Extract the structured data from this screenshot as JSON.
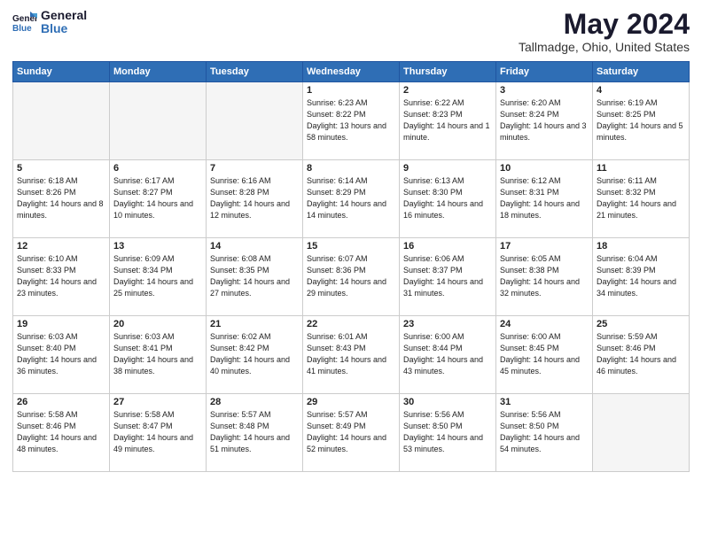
{
  "header": {
    "logo_general": "General",
    "logo_blue": "Blue",
    "month_title": "May 2024",
    "location": "Tallmadge, Ohio, United States"
  },
  "weekdays": [
    "Sunday",
    "Monday",
    "Tuesday",
    "Wednesday",
    "Thursday",
    "Friday",
    "Saturday"
  ],
  "weeks": [
    [
      {
        "day": "",
        "empty": true
      },
      {
        "day": "",
        "empty": true
      },
      {
        "day": "",
        "empty": true
      },
      {
        "day": "1",
        "sunrise": "6:23 AM",
        "sunset": "8:22 PM",
        "daylight": "13 hours and 58 minutes."
      },
      {
        "day": "2",
        "sunrise": "6:22 AM",
        "sunset": "8:23 PM",
        "daylight": "14 hours and 1 minute."
      },
      {
        "day": "3",
        "sunrise": "6:20 AM",
        "sunset": "8:24 PM",
        "daylight": "14 hours and 3 minutes."
      },
      {
        "day": "4",
        "sunrise": "6:19 AM",
        "sunset": "8:25 PM",
        "daylight": "14 hours and 5 minutes."
      }
    ],
    [
      {
        "day": "5",
        "sunrise": "6:18 AM",
        "sunset": "8:26 PM",
        "daylight": "14 hours and 8 minutes."
      },
      {
        "day": "6",
        "sunrise": "6:17 AM",
        "sunset": "8:27 PM",
        "daylight": "14 hours and 10 minutes."
      },
      {
        "day": "7",
        "sunrise": "6:16 AM",
        "sunset": "8:28 PM",
        "daylight": "14 hours and 12 minutes."
      },
      {
        "day": "8",
        "sunrise": "6:14 AM",
        "sunset": "8:29 PM",
        "daylight": "14 hours and 14 minutes."
      },
      {
        "day": "9",
        "sunrise": "6:13 AM",
        "sunset": "8:30 PM",
        "daylight": "14 hours and 16 minutes."
      },
      {
        "day": "10",
        "sunrise": "6:12 AM",
        "sunset": "8:31 PM",
        "daylight": "14 hours and 18 minutes."
      },
      {
        "day": "11",
        "sunrise": "6:11 AM",
        "sunset": "8:32 PM",
        "daylight": "14 hours and 21 minutes."
      }
    ],
    [
      {
        "day": "12",
        "sunrise": "6:10 AM",
        "sunset": "8:33 PM",
        "daylight": "14 hours and 23 minutes."
      },
      {
        "day": "13",
        "sunrise": "6:09 AM",
        "sunset": "8:34 PM",
        "daylight": "14 hours and 25 minutes."
      },
      {
        "day": "14",
        "sunrise": "6:08 AM",
        "sunset": "8:35 PM",
        "daylight": "14 hours and 27 minutes."
      },
      {
        "day": "15",
        "sunrise": "6:07 AM",
        "sunset": "8:36 PM",
        "daylight": "14 hours and 29 minutes."
      },
      {
        "day": "16",
        "sunrise": "6:06 AM",
        "sunset": "8:37 PM",
        "daylight": "14 hours and 31 minutes."
      },
      {
        "day": "17",
        "sunrise": "6:05 AM",
        "sunset": "8:38 PM",
        "daylight": "14 hours and 32 minutes."
      },
      {
        "day": "18",
        "sunrise": "6:04 AM",
        "sunset": "8:39 PM",
        "daylight": "14 hours and 34 minutes."
      }
    ],
    [
      {
        "day": "19",
        "sunrise": "6:03 AM",
        "sunset": "8:40 PM",
        "daylight": "14 hours and 36 minutes."
      },
      {
        "day": "20",
        "sunrise": "6:03 AM",
        "sunset": "8:41 PM",
        "daylight": "14 hours and 38 minutes."
      },
      {
        "day": "21",
        "sunrise": "6:02 AM",
        "sunset": "8:42 PM",
        "daylight": "14 hours and 40 minutes."
      },
      {
        "day": "22",
        "sunrise": "6:01 AM",
        "sunset": "8:43 PM",
        "daylight": "14 hours and 41 minutes."
      },
      {
        "day": "23",
        "sunrise": "6:00 AM",
        "sunset": "8:44 PM",
        "daylight": "14 hours and 43 minutes."
      },
      {
        "day": "24",
        "sunrise": "6:00 AM",
        "sunset": "8:45 PM",
        "daylight": "14 hours and 45 minutes."
      },
      {
        "day": "25",
        "sunrise": "5:59 AM",
        "sunset": "8:46 PM",
        "daylight": "14 hours and 46 minutes."
      }
    ],
    [
      {
        "day": "26",
        "sunrise": "5:58 AM",
        "sunset": "8:46 PM",
        "daylight": "14 hours and 48 minutes."
      },
      {
        "day": "27",
        "sunrise": "5:58 AM",
        "sunset": "8:47 PM",
        "daylight": "14 hours and 49 minutes."
      },
      {
        "day": "28",
        "sunrise": "5:57 AM",
        "sunset": "8:48 PM",
        "daylight": "14 hours and 51 minutes."
      },
      {
        "day": "29",
        "sunrise": "5:57 AM",
        "sunset": "8:49 PM",
        "daylight": "14 hours and 52 minutes."
      },
      {
        "day": "30",
        "sunrise": "5:56 AM",
        "sunset": "8:50 PM",
        "daylight": "14 hours and 53 minutes."
      },
      {
        "day": "31",
        "sunrise": "5:56 AM",
        "sunset": "8:50 PM",
        "daylight": "14 hours and 54 minutes."
      },
      {
        "day": "",
        "empty": true
      }
    ]
  ],
  "labels": {
    "sunrise": "Sunrise:",
    "sunset": "Sunset:",
    "daylight": "Daylight:"
  }
}
